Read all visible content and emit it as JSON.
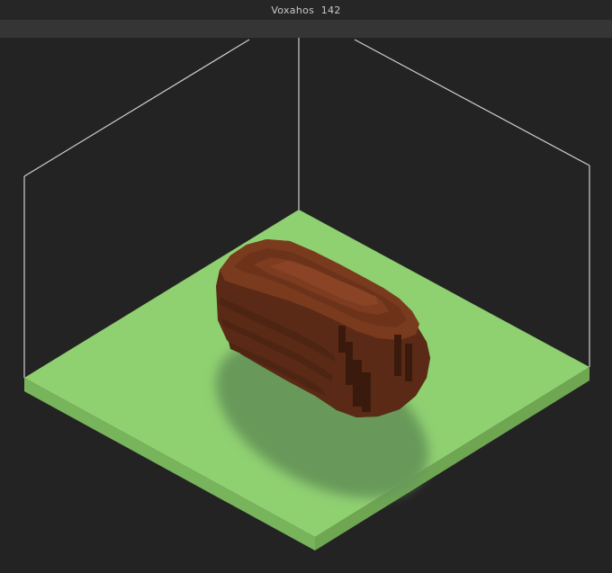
{
  "window": {
    "app_name": "Voxahos",
    "build": "142"
  },
  "scene": {
    "ground_color": "#8fd071",
    "ground_side_left": "#78b45c",
    "ground_side_right": "#6ea652",
    "shadow_color": "#67995a",
    "model_top": "#7a3a1e",
    "model_left": "#5a2a16",
    "model_right": "#462010",
    "frame_line_color": "#cfcfcf",
    "background_color": "#232323"
  }
}
